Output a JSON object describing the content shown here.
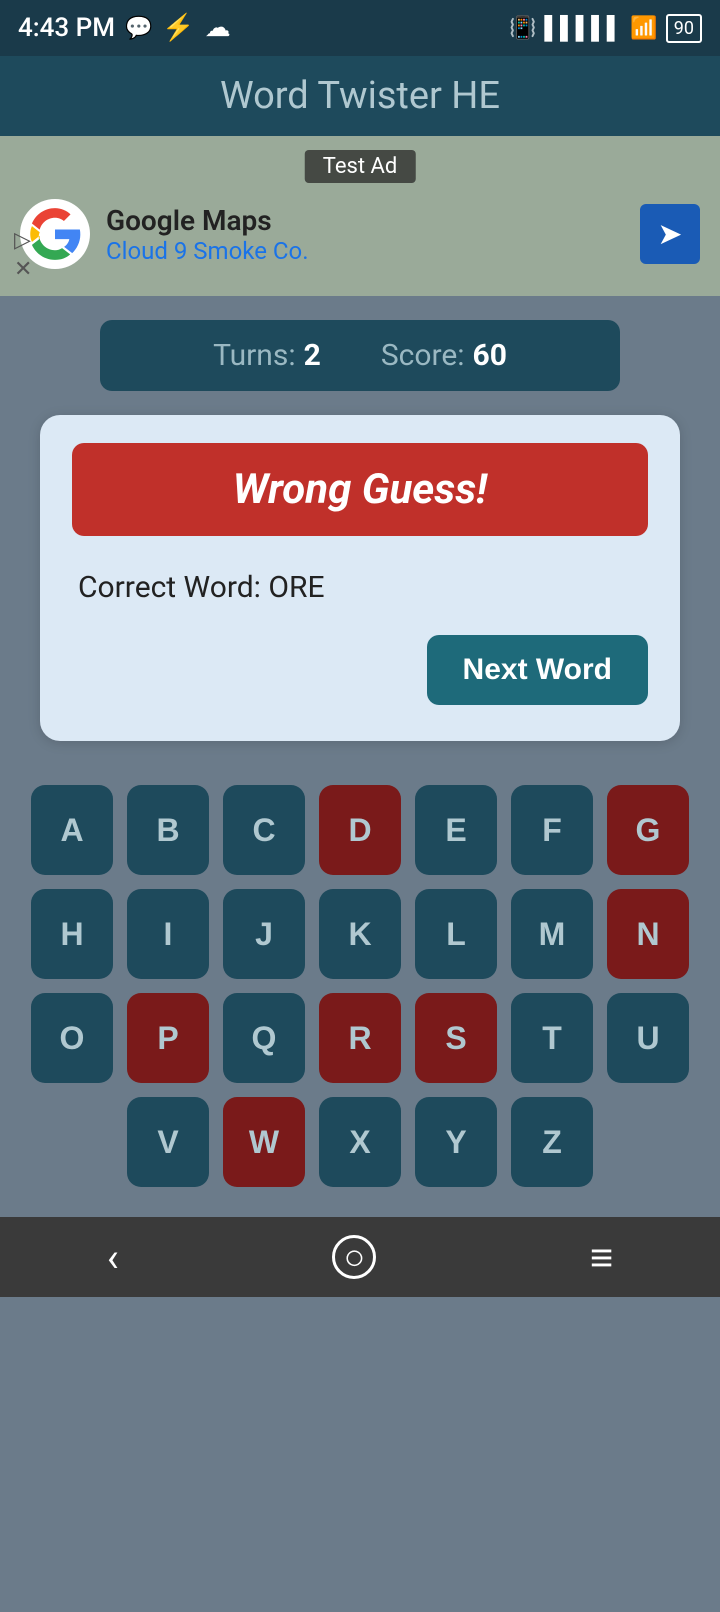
{
  "statusBar": {
    "time": "4:43 PM",
    "icons": [
      "whatsapp",
      "usb",
      "cloud"
    ]
  },
  "header": {
    "title": "Word Twister HE"
  },
  "ad": {
    "label": "Test Ad",
    "company": "Google Maps",
    "subtitle": "Cloud 9 Smoke Co."
  },
  "scoreBar": {
    "turnsLabel": "Turns:",
    "turnsValue": "2",
    "scoreLabel": "Score:",
    "scoreValue": "60"
  },
  "resultCard": {
    "wrongGuessTitle": "Wrong Guess!",
    "correctWordLabel": "Correct Word: ORE",
    "nextWordButton": "Next Word"
  },
  "keyboard": {
    "rows": [
      [
        "A",
        "B",
        "C",
        "D",
        "E",
        "F",
        "G"
      ],
      [
        "H",
        "I",
        "J",
        "K",
        "L",
        "M",
        "N"
      ],
      [
        "O",
        "P",
        "Q",
        "R",
        "S",
        "T",
        "U"
      ],
      [
        "V",
        "W",
        "X",
        "Y",
        "Z"
      ]
    ],
    "usedKeys": [
      "D",
      "G",
      "N",
      "P",
      "R",
      "S",
      "W"
    ]
  },
  "bottomNav": {
    "backIcon": "‹",
    "homeIcon": "○",
    "menuIcon": "≡"
  }
}
